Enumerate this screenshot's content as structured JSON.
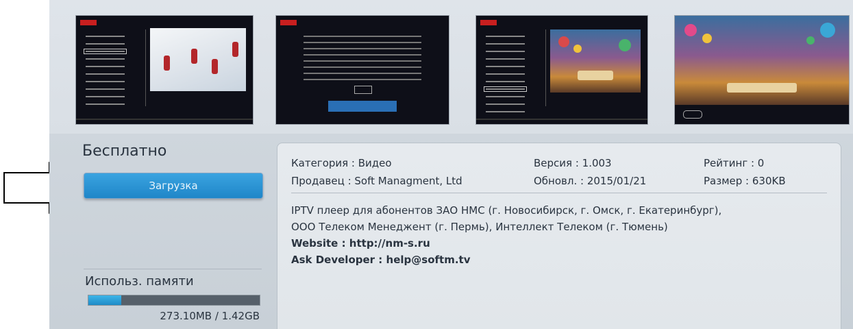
{
  "app": {
    "price_label": "Бесплатно",
    "download_button": "Загрузка",
    "memory_label": "Использ. памяти",
    "memory_value": "273.10MB / 1.42GB",
    "memory_used_fraction": 0.19
  },
  "meta": {
    "category": "Категория : Видео",
    "seller": "Продавец : Soft Managment, Ltd",
    "version": "Версия : 1.003",
    "updated": "Обновл. : 2015/01/21",
    "rating": "Рейтинг : 0",
    "size": "Размер : 630KB"
  },
  "description": {
    "line1": "IPTV плеер для абонентов ЗАО НМС (г. Новосибирск, г. Омск, г. Екатеринбург),",
    "line2": "ООО Телеком Менеджент (г. Пермь), Интеллект Телеком (г. Тюмень)",
    "website_key": "Website",
    "website_value": "http://nm-s.ru",
    "developer_key": "Ask Developer",
    "developer_value": "help@softm.tv"
  },
  "colors": {
    "accent": "#1f86c8",
    "panel": "#e3e8ec",
    "text": "#2a3440"
  }
}
